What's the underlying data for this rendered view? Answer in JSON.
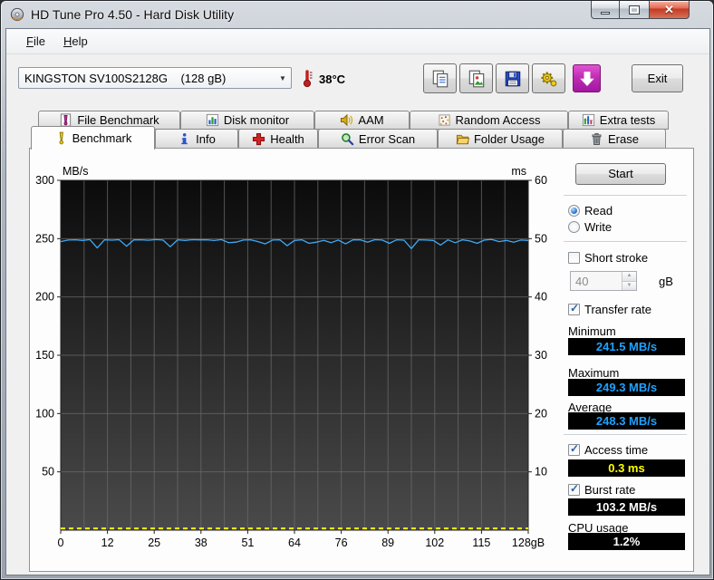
{
  "window": {
    "title": "HD Tune Pro 4.50 - Hard Disk Utility",
    "controls": [
      "minimize",
      "maximize",
      "close"
    ]
  },
  "menu": {
    "items": [
      {
        "label": "File"
      },
      {
        "label": "Help"
      }
    ]
  },
  "toolbar": {
    "drive_select": "KINGSTON SV100S2128G    (128 gB)",
    "temperature": "38°C",
    "buttons": [
      {
        "name": "copy-text-button",
        "icon": "copy-icon"
      },
      {
        "name": "copy-image-button",
        "icon": "copy-image-icon"
      },
      {
        "name": "save-button",
        "icon": "save-icon"
      },
      {
        "name": "options-button",
        "icon": "options-icon"
      },
      {
        "name": "update-button",
        "icon": "down-arrow-icon"
      }
    ],
    "exit_label": "Exit"
  },
  "tabs": {
    "row1": [
      {
        "label": "File Benchmark",
        "icon": "file-benchmark-icon"
      },
      {
        "label": "Disk monitor",
        "icon": "disk-monitor-icon"
      },
      {
        "label": "AAM",
        "icon": "aam-icon"
      },
      {
        "label": "Random Access",
        "icon": "random-access-icon"
      },
      {
        "label": "Extra tests",
        "icon": "extra-tests-icon"
      }
    ],
    "row2": [
      {
        "label": "Benchmark",
        "icon": "benchmark-icon"
      },
      {
        "label": "Info",
        "icon": "info-icon"
      },
      {
        "label": "Health",
        "icon": "health-icon"
      },
      {
        "label": "Error Scan",
        "icon": "error-scan-icon"
      },
      {
        "label": "Folder Usage",
        "icon": "folder-usage-icon"
      },
      {
        "label": "Erase",
        "icon": "erase-icon"
      }
    ],
    "active": "Benchmark"
  },
  "panel": {
    "start_label": "Start",
    "read_label": "Read",
    "write_label": "Write",
    "short_stroke_label": "Short stroke",
    "short_stroke_value": "40",
    "short_stroke_unit": "gB",
    "transfer_rate_label": "Transfer rate",
    "minimum_label": "Minimum",
    "minimum_value": "241.5 MB/s",
    "maximum_label": "Maximum",
    "maximum_value": "249.3 MB/s",
    "average_label": "Average",
    "average_value": "248.3 MB/s",
    "access_time_label": "Access time",
    "access_time_value": "0.3 ms",
    "burst_rate_label": "Burst rate",
    "burst_rate_value": "103.2 MB/s",
    "cpu_usage_label": "CPU usage",
    "cpu_usage_value": "1.2%"
  },
  "colors": {
    "value_blue": "#1ea2ff",
    "value_yellow": "#ffff00",
    "value_white": "#ffffff",
    "update_button_magenta": "#c02cb4"
  },
  "chart_data": {
    "type": "line",
    "title": "",
    "left_axis": {
      "label": "MB/s",
      "min": 0,
      "max": 300,
      "ticks": [
        300,
        250,
        200,
        150,
        100,
        50
      ]
    },
    "right_axis": {
      "label": "ms",
      "min": 0,
      "max": 60,
      "ticks": [
        60,
        50,
        40,
        30,
        20,
        10
      ]
    },
    "x_axis": {
      "min": 0,
      "max": 128,
      "tick_labels": [
        "0",
        "12",
        "25",
        "38",
        "51",
        "64",
        "76",
        "89",
        "102",
        "115",
        "128gB"
      ]
    },
    "grid": {
      "horizontal_step": 50,
      "vertical_divisions": 20,
      "color": "#6a6a6a"
    },
    "plot_bg": [
      "#0b0b0b",
      "#4a4a4a"
    ],
    "legend": "none",
    "series": [
      {
        "name": "transfer-rate",
        "axis": "left",
        "color": "#3fa9f5",
        "style": "solid",
        "x": [
          0,
          2,
          4,
          6,
          8,
          10,
          12,
          14,
          16,
          18,
          20,
          22,
          24,
          26,
          28,
          30,
          32,
          34,
          36,
          38,
          40,
          42,
          44,
          46,
          48,
          50,
          52,
          54,
          56,
          58,
          60,
          62,
          64,
          66,
          68,
          70,
          72,
          74,
          76,
          78,
          80,
          82,
          84,
          86,
          88,
          90,
          92,
          94,
          96,
          98,
          100,
          102,
          104,
          106,
          108,
          110,
          112,
          114,
          116,
          118,
          120,
          122,
          124,
          126,
          128
        ],
        "values": [
          247.5,
          248.8,
          249.0,
          248.5,
          249.2,
          242.0,
          249.0,
          248.7,
          249.1,
          243.5,
          248.9,
          249.0,
          248.6,
          249.2,
          248.8,
          243.0,
          249.0,
          248.5,
          249.1,
          248.9,
          249.0,
          248.4,
          249.2,
          246.5,
          247.0,
          248.8,
          249.0,
          247.5,
          245.5,
          248.8,
          249.0,
          244.0,
          248.5,
          249.0,
          246.0,
          247.0,
          248.5,
          246.5,
          248.8,
          245.5,
          248.9,
          249.0,
          247.0,
          249.1,
          248.8,
          246.0,
          249.0,
          248.7,
          241.5,
          249.0,
          248.8,
          248.5,
          244.5,
          248.9,
          246.5,
          249.0,
          248.0,
          246.0,
          248.8,
          249.3,
          247.5,
          248.5,
          247.0,
          248.8,
          248.5
        ]
      },
      {
        "name": "access-time",
        "axis": "right",
        "color": "#ffff00",
        "style": "dashed",
        "x": [
          0,
          128
        ],
        "values": [
          0.3,
          0.3
        ]
      }
    ]
  }
}
